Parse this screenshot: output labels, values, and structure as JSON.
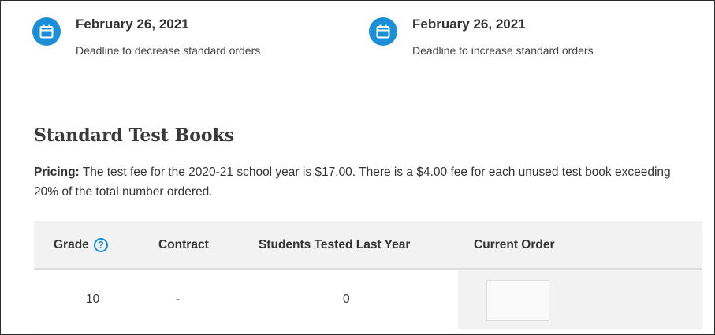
{
  "deadlines": [
    {
      "date": "February 26, 2021",
      "description": "Deadline to decrease standard orders",
      "icon": "calendar-icon"
    },
    {
      "date": "February 26, 2021",
      "description": "Deadline to increase standard orders",
      "icon": "calendar-icon"
    }
  ],
  "section": {
    "title": "Standard Test Books",
    "pricing_label": "Pricing:",
    "pricing_text": " The test fee for the 2020-21 school year is $17.00. There is a $4.00 fee for each unused test book exceeding 20% of the total number ordered."
  },
  "table": {
    "headers": {
      "grade": "Grade",
      "contract": "Contract",
      "students": "Students Tested Last Year",
      "current": "Current Order"
    },
    "help_icon": "?",
    "rows": [
      {
        "grade": "10",
        "contract": "-",
        "students": "0",
        "current_order": ""
      }
    ]
  },
  "colors": {
    "accent": "#1a8fd8",
    "header_bg": "#f2f2f2"
  }
}
